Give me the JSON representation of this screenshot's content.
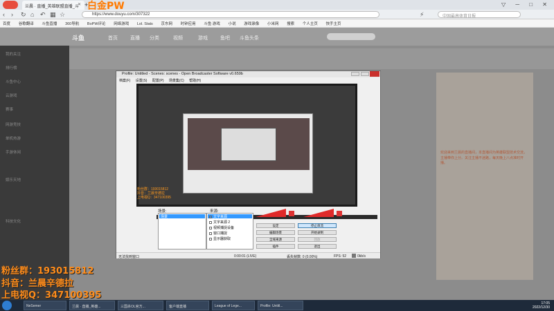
{
  "browser": {
    "tab_title": "兰晨 · 直播_英雄联盟直播_斗",
    "watermark": "白金PW",
    "url": "https://www.douyu.com/307322",
    "search_placeholder": "中国最高体育日报",
    "bookmarks": [
      "百度",
      "谷歌翻译",
      "斗鱼直播",
      "360导航",
      "BoPW评论",
      "网络游戏",
      "Lol. Stats",
      "京东网",
      "时钟应用",
      "斗鱼 游戏",
      "小说",
      "游戏录像",
      "小米网",
      "搜索",
      "个人主页",
      "快手主页"
    ]
  },
  "douyu": {
    "logo": "斗鱼",
    "nav": [
      "首页",
      "直播",
      "分类",
      "视频",
      "游戏",
      "鱼吧",
      "斗鱼头条"
    ],
    "sidebar": [
      "我的关注",
      "排行榜",
      "斗鱼中心",
      "云游戏",
      "赛事",
      "网游竞技",
      "单机热游",
      "手游休闲",
      "娱乐天地",
      "科技文化"
    ],
    "right_text": "欢迎来到兰晨的直播间，本直播间为英雄联盟技术交流，主播带你上分。关注主播不迷路，每天晚上八点准时开播。"
  },
  "obs": {
    "title": "Profile: Untitled - Scenes: scenes - Open Broadcaster Software v0.659b",
    "menu": [
      "档案(F)",
      "设置(S)",
      "配置(P)",
      "场景集(C)",
      "帮助(H)"
    ],
    "scenes_label": "场景:",
    "sources_label": "来源:",
    "scene_selected": "场景",
    "sources": [
      "文字来源",
      "文字来源 2",
      "视频捕捉设备",
      "窗口捕捉",
      "显示器获取"
    ],
    "buttons": {
      "settings": "设定",
      "stop_stream": "停止串流",
      "edit_scene": "编辑场景",
      "start_record": "开始录制",
      "global_sources": "全域来源",
      "replay": "回放",
      "plugins": "插件",
      "exit": "退出"
    },
    "status": {
      "message": "无法找到窗口",
      "time": "0:00:01 (LIVE)",
      "dropped": "丢失帧数: 0 (0.00%)",
      "fps": "FPS: 52",
      "bitrate": "0kb/s"
    },
    "overlay_lines": [
      "粉丝群：193015812",
      "抖音：兰晨辛德拉",
      "上电视Q：347100395"
    ]
  },
  "stream_overlay": {
    "fan_group": "粉丝群：193015812",
    "douyin": "抖音：兰晨辛德拉",
    "tv_qq": "上电视Q：347100395"
  },
  "taskbar": {
    "items": [
      "NeSemer",
      "兰晨 · 直播_英雄...",
      "三国杀OL官方...",
      "客户端直播",
      "League of Lege...",
      "Profile: Untitl..."
    ],
    "time": "17:05",
    "date": "2022/12/30"
  }
}
